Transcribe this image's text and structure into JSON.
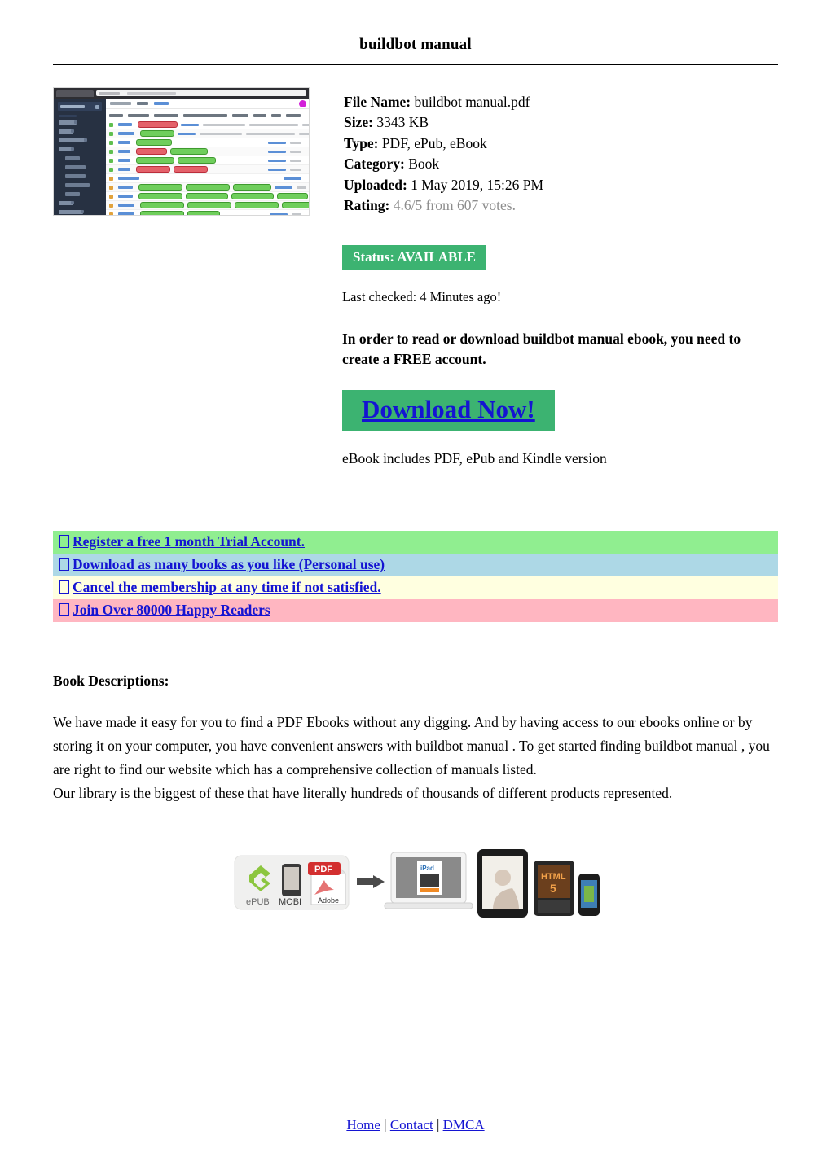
{
  "document": {
    "title": "buildbot manual"
  },
  "meta": {
    "file_name_label": "File Name:",
    "file_name_value": "buildbot manual.pdf",
    "size_label": "Size:",
    "size_value": "3343 KB",
    "type_label": "Type:",
    "type_value": "PDF, ePub, eBook",
    "category_label": "Category:",
    "category_value": "Book",
    "uploaded_label": "Uploaded:",
    "uploaded_value": "1 May 2019, 15:26 PM",
    "rating_label": "Rating:",
    "rating_value": "4.6/5 from 607 votes."
  },
  "status": {
    "badge": "Status: AVAILABLE",
    "badge_color": "#3cb371",
    "last_checked": "Last checked: 4 Minutes ago!"
  },
  "cta": {
    "headline": "In order to read or download buildbot manual ebook, you need to create a FREE account.",
    "download_label": "Download Now!",
    "download_bg": "#3cb371",
    "download_link_color": "#1414d2",
    "includes": "eBook includes PDF, ePub and Kindle version"
  },
  "benefits": [
    {
      "label": "Register a free 1 month Trial Account.",
      "bg": "#90ee90"
    },
    {
      "label": "Download as many books as you like (Personal use)",
      "bg": "#add8e6"
    },
    {
      "label": "Cancel the membership at any time if not satisfied.",
      "bg": "#ffffe0"
    },
    {
      "label": "Join Over 80000 Happy Readers",
      "bg": "#ffb6c1"
    }
  ],
  "descriptions": {
    "heading": "Book Descriptions:",
    "paragraphs": [
      "We have made it easy for you to find a PDF Ebooks without any digging. And by having access to our ebooks online or by storing it on your computer, you have convenient answers with buildbot manual . To get started finding buildbot manual , you are right to find our website which has a comprehensive collection of manuals listed.",
      "Our library is the biggest of these that have literally hundreds of thousands of different products represented."
    ]
  },
  "devices_graphic": {
    "formats": [
      "ePUB",
      "MOBI",
      "PDF"
    ],
    "pdf_badge": "PDF",
    "adobe_label": "Adobe",
    "ipad_label": "iPad",
    "html5_label": "HTML",
    "html5_version": "5"
  },
  "thumbnail": {
    "description": "buildbot web interface screenshot"
  },
  "footer": {
    "home": "Home",
    "contact": "Contact",
    "dmca": "DMCA",
    "separator": "|"
  }
}
